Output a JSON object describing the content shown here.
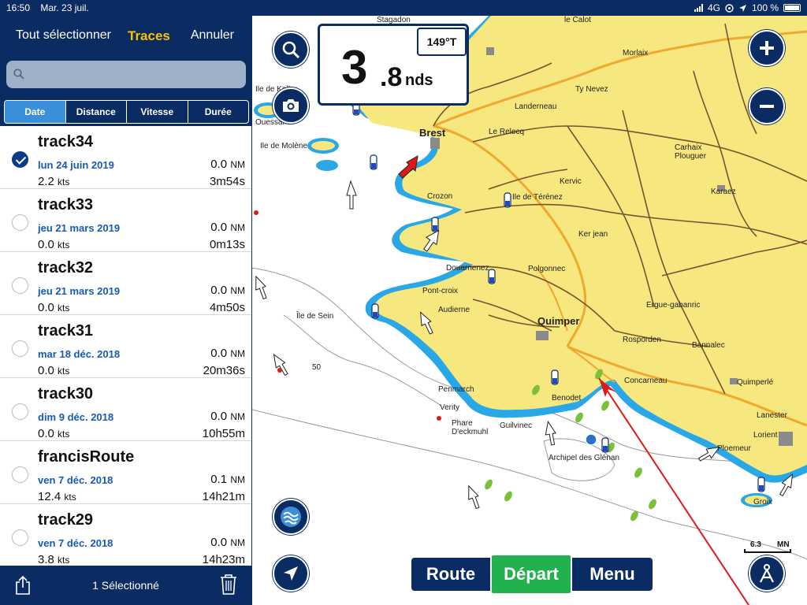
{
  "status": {
    "time": "16:50",
    "date": "Mar. 23 juil.",
    "network": "4G",
    "battery": "100 %"
  },
  "panel": {
    "select_all": "Tout sélectionner",
    "title": "Traces",
    "cancel": "Annuler",
    "search": {
      "placeholder": "",
      "value": ""
    },
    "segments": [
      "Date",
      "Distance",
      "Vitesse",
      "Durée"
    ],
    "active_segment": "Date",
    "tracks": [
      {
        "name": "track34",
        "date": "lun 24 juin 2019",
        "dist_value": "0.0",
        "dist_unit": "NM",
        "speed_value": "2.2",
        "speed_unit": "kts",
        "duration": "3m54s",
        "selected": true
      },
      {
        "name": "track33",
        "date": "jeu 21 mars 2019",
        "dist_value": "0.0",
        "dist_unit": "NM",
        "speed_value": "0.0",
        "speed_unit": "kts",
        "duration": "0m13s",
        "selected": false
      },
      {
        "name": "track32",
        "date": "jeu 21 mars 2019",
        "dist_value": "0.0",
        "dist_unit": "NM",
        "speed_value": "0.0",
        "speed_unit": "kts",
        "duration": "4m50s",
        "selected": false
      },
      {
        "name": "track31",
        "date": "mar 18 déc. 2018",
        "dist_value": "0.0",
        "dist_unit": "NM",
        "speed_value": "0.0",
        "speed_unit": "kts",
        "duration": "20m36s",
        "selected": false
      },
      {
        "name": "track30",
        "date": "dim 9 déc. 2018",
        "dist_value": "0.0",
        "dist_unit": "NM",
        "speed_value": "0.0",
        "speed_unit": "kts",
        "duration": "10h55m",
        "selected": false
      },
      {
        "name": "francisRoute",
        "date": "ven 7 déc. 2018",
        "dist_value": "0.1",
        "dist_unit": "NM",
        "speed_value": "12.4",
        "speed_unit": "kts",
        "duration": "14h21m",
        "selected": false
      },
      {
        "name": "track29",
        "date": "ven 7 déc. 2018",
        "dist_value": "0.0",
        "dist_unit": "NM",
        "speed_value": "3.8",
        "speed_unit": "kts",
        "duration": "14h23m",
        "selected": false
      }
    ],
    "footer": {
      "selected_count": "1 Sélectionné"
    }
  },
  "map": {
    "speed": {
      "integer": "3",
      "decimal": ".8",
      "unit": "nds"
    },
    "heading": "149°T",
    "scale": {
      "value": "6.3",
      "unit": "MN"
    },
    "depth_label": "50",
    "tabs": {
      "route": "Route",
      "depart": "Départ",
      "menu": "Menu"
    },
    "places": [
      {
        "name": "Stagadon",
        "big": false
      },
      {
        "name": "le Calot",
        "big": false
      },
      {
        "name": "Morlaix",
        "big": false
      },
      {
        "name": "Landerneau",
        "big": false
      },
      {
        "name": "Ty Nevez",
        "big": false
      },
      {
        "name": "Brest",
        "big": true
      },
      {
        "name": "Le Relecq",
        "big": false
      },
      {
        "name": "Ouessant",
        "big": false
      },
      {
        "name": "Ile de Molène",
        "big": false
      },
      {
        "name": "Carhaix Plouguer",
        "big": false
      },
      {
        "name": "Crozon",
        "big": false
      },
      {
        "name": "Ile de Térénez",
        "big": false
      },
      {
        "name": "Kervic",
        "big": false
      },
      {
        "name": "Karaez",
        "big": false
      },
      {
        "name": "Ker jean",
        "big": false
      },
      {
        "name": "Douarnenez",
        "big": false
      },
      {
        "name": "Polgonnec",
        "big": false
      },
      {
        "name": "Pont-croix",
        "big": false
      },
      {
        "name": "Ergue-gabanric",
        "big": false
      },
      {
        "name": "Île de Sein",
        "big": false
      },
      {
        "name": "Audierne",
        "big": false
      },
      {
        "name": "Quimper",
        "big": true
      },
      {
        "name": "Rosporden",
        "big": false
      },
      {
        "name": "Bannalec",
        "big": false
      },
      {
        "name": "Concarneau",
        "big": false
      },
      {
        "name": "Quimperlé",
        "big": false
      },
      {
        "name": "Penmarch",
        "big": false
      },
      {
        "name": "Verity",
        "big": false
      },
      {
        "name": "Benodet",
        "big": false
      },
      {
        "name": "Phare D'eckmuhl",
        "big": false
      },
      {
        "name": "Guilvinec",
        "big": false
      },
      {
        "name": "Archipel des Glénan",
        "big": false
      },
      {
        "name": "Lanester",
        "big": false
      },
      {
        "name": "Lorient",
        "big": false
      },
      {
        "name": "Ploemeur",
        "big": false
      },
      {
        "name": "Groix",
        "big": false
      },
      {
        "name": "Ile de Keller",
        "big": false
      }
    ],
    "colors": {
      "land": "#f6e77e",
      "shallow": "#29a7e6",
      "road": "#f0a830",
      "panel": "#0b2c63",
      "depart": "#22b14c",
      "track": "#e01818"
    }
  }
}
